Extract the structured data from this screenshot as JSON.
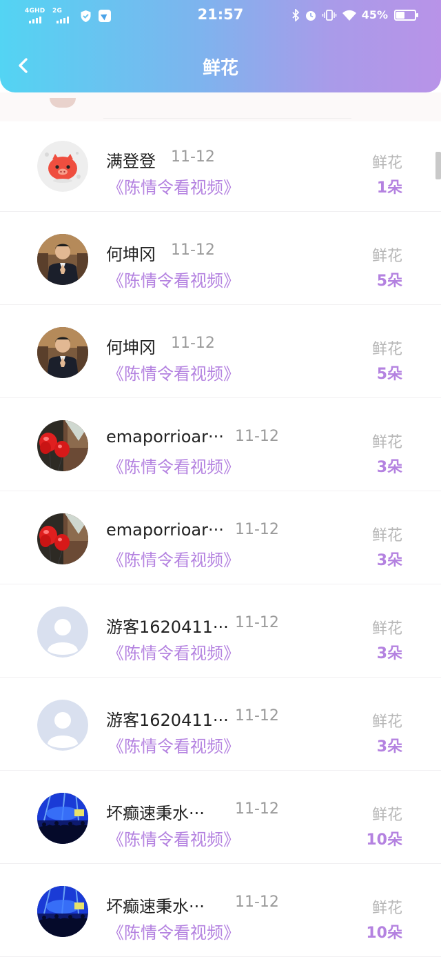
{
  "status_bar": {
    "signal1_label": "4GHD",
    "signal2_label": "2G",
    "time": "21:57",
    "battery_percent": "45%"
  },
  "nav": {
    "title": "鲜花"
  },
  "list": {
    "items": [
      {
        "name": "满登登",
        "date": "11-12",
        "subtitle": "《陈情令看视频》",
        "gift": "鲜花",
        "count": "1朵",
        "avatar": "pig-avatar"
      },
      {
        "name": "何坤冈",
        "date": "11-12",
        "subtitle": "《陈情令看视频》",
        "gift": "鲜花",
        "count": "5朵",
        "avatar": "man-avatar"
      },
      {
        "name": "何坤冈",
        "date": "11-12",
        "subtitle": "《陈情令看视频》",
        "gift": "鲜花",
        "count": "5朵",
        "avatar": "man-avatar"
      },
      {
        "name": "emaporrioar···",
        "date": "11-12",
        "subtitle": "《陈情令看视频》",
        "gift": "鲜花",
        "count": "3朵",
        "avatar": "balloon-avatar"
      },
      {
        "name": "emaporrioar···",
        "date": "11-12",
        "subtitle": "《陈情令看视频》",
        "gift": "鲜花",
        "count": "3朵",
        "avatar": "balloon-avatar"
      },
      {
        "name": "游客1620411···",
        "date": "11-12",
        "subtitle": "《陈情令看视频》",
        "gift": "鲜花",
        "count": "3朵",
        "avatar": "default-avatar"
      },
      {
        "name": "游客1620411···",
        "date": "11-12",
        "subtitle": "《陈情令看视频》",
        "gift": "鲜花",
        "count": "3朵",
        "avatar": "default-avatar"
      },
      {
        "name": "坏癫速秉水···",
        "date": "11-12",
        "subtitle": "《陈情令看视频》",
        "gift": "鲜花",
        "count": "10朵",
        "avatar": "concert-avatar"
      },
      {
        "name": "坏癫速秉水···",
        "date": "11-12",
        "subtitle": "《陈情令看视频》",
        "gift": "鲜花",
        "count": "10朵",
        "avatar": "concert-avatar"
      }
    ]
  },
  "colors": {
    "accent_purple": "#b482e0",
    "header_gradient_start": "#53d4f3",
    "header_gradient_end": "#b893e8"
  }
}
